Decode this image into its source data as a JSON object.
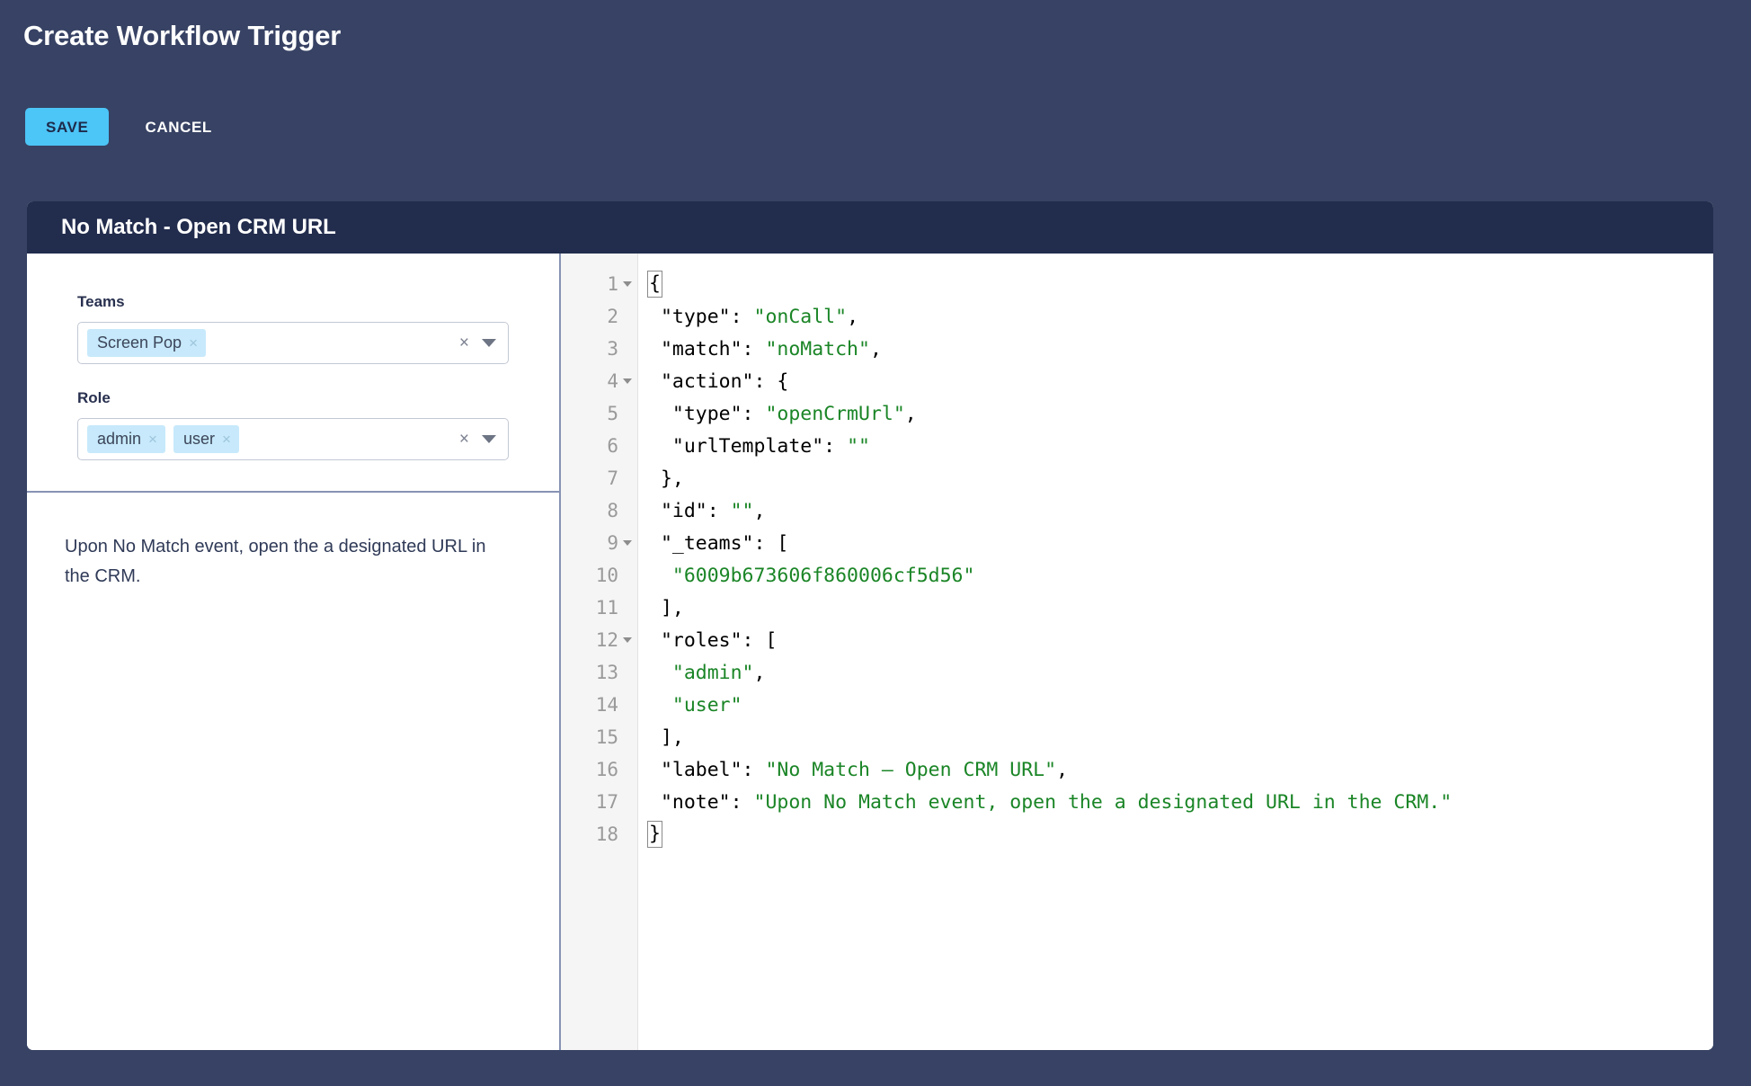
{
  "page": {
    "title": "Create Workflow Trigger",
    "background_color": "#374264"
  },
  "toolbar": {
    "save_label": "SAVE",
    "cancel_label": "CANCEL",
    "save_bg_color": "#4cc5f7",
    "save_text_color": "#1e2a4a"
  },
  "card": {
    "header_title": "No Match - Open CRM URL",
    "header_bg_color": "#222c4d"
  },
  "form": {
    "teams": {
      "label": "Teams",
      "chips": [
        {
          "label": "Screen Pop",
          "remove_icon": "×"
        }
      ],
      "clear_icon": "×",
      "caret_icon": "chevron-down-icon",
      "chip_bg_color": "#c7e9fb"
    },
    "role": {
      "label": "Role",
      "chips": [
        {
          "label": "admin",
          "remove_icon": "×"
        },
        {
          "label": "user",
          "remove_icon": "×"
        }
      ],
      "clear_icon": "×",
      "caret_icon": "chevron-down-icon"
    }
  },
  "description": {
    "text": "Upon No Match event, open the a designated URL in the CRM."
  },
  "editor": {
    "string_color": "#1a8526",
    "gutter_bg_color": "#f5f5f5",
    "lines": [
      {
        "num": "1",
        "fold": true,
        "segments": [
          {
            "t": "{",
            "c": "brace"
          }
        ]
      },
      {
        "num": "2",
        "fold": false,
        "segments": [
          {
            "t": " \"type\": ",
            "c": "key"
          },
          {
            "t": "\"onCall\"",
            "c": "str"
          },
          {
            "t": ",",
            "c": "punc"
          }
        ]
      },
      {
        "num": "3",
        "fold": false,
        "segments": [
          {
            "t": " \"match\": ",
            "c": "key"
          },
          {
            "t": "\"noMatch\"",
            "c": "str"
          },
          {
            "t": ",",
            "c": "punc"
          }
        ]
      },
      {
        "num": "4",
        "fold": true,
        "segments": [
          {
            "t": " \"action\": {",
            "c": "key"
          }
        ]
      },
      {
        "num": "5",
        "fold": false,
        "segments": [
          {
            "t": "  \"type\": ",
            "c": "key"
          },
          {
            "t": "\"openCrmUrl\"",
            "c": "str"
          },
          {
            "t": ",",
            "c": "punc"
          }
        ]
      },
      {
        "num": "6",
        "fold": false,
        "segments": [
          {
            "t": "  \"urlTemplate\": ",
            "c": "key"
          },
          {
            "t": "\"\"",
            "c": "str"
          }
        ]
      },
      {
        "num": "7",
        "fold": false,
        "segments": [
          {
            "t": " },",
            "c": "punc"
          }
        ]
      },
      {
        "num": "8",
        "fold": false,
        "segments": [
          {
            "t": " \"id\": ",
            "c": "key"
          },
          {
            "t": "\"\"",
            "c": "str"
          },
          {
            "t": ",",
            "c": "punc"
          }
        ]
      },
      {
        "num": "9",
        "fold": true,
        "segments": [
          {
            "t": " \"_teams\": [",
            "c": "key"
          }
        ]
      },
      {
        "num": "10",
        "fold": false,
        "segments": [
          {
            "t": "  ",
            "c": "key"
          },
          {
            "t": "\"6009b673606f860006cf5d56\"",
            "c": "str"
          }
        ]
      },
      {
        "num": "11",
        "fold": false,
        "segments": [
          {
            "t": " ],",
            "c": "punc"
          }
        ]
      },
      {
        "num": "12",
        "fold": true,
        "segments": [
          {
            "t": " \"roles\": [",
            "c": "key"
          }
        ]
      },
      {
        "num": "13",
        "fold": false,
        "segments": [
          {
            "t": "  ",
            "c": "key"
          },
          {
            "t": "\"admin\"",
            "c": "str"
          },
          {
            "t": ",",
            "c": "punc"
          }
        ]
      },
      {
        "num": "14",
        "fold": false,
        "segments": [
          {
            "t": "  ",
            "c": "key"
          },
          {
            "t": "\"user\"",
            "c": "str"
          }
        ]
      },
      {
        "num": "15",
        "fold": false,
        "segments": [
          {
            "t": " ],",
            "c": "punc"
          }
        ]
      },
      {
        "num": "16",
        "fold": false,
        "segments": [
          {
            "t": " \"label\": ",
            "c": "key"
          },
          {
            "t": "\"No Match – Open CRM URL\"",
            "c": "str"
          },
          {
            "t": ",",
            "c": "punc"
          }
        ]
      },
      {
        "num": "17",
        "fold": false,
        "segments": [
          {
            "t": " \"note\": ",
            "c": "key"
          },
          {
            "t": "\"Upon No Match event, open the a designated URL in the CRM.\"",
            "c": "str"
          }
        ]
      },
      {
        "num": "18",
        "fold": false,
        "segments": [
          {
            "t": "}",
            "c": "brace"
          }
        ]
      }
    ]
  }
}
